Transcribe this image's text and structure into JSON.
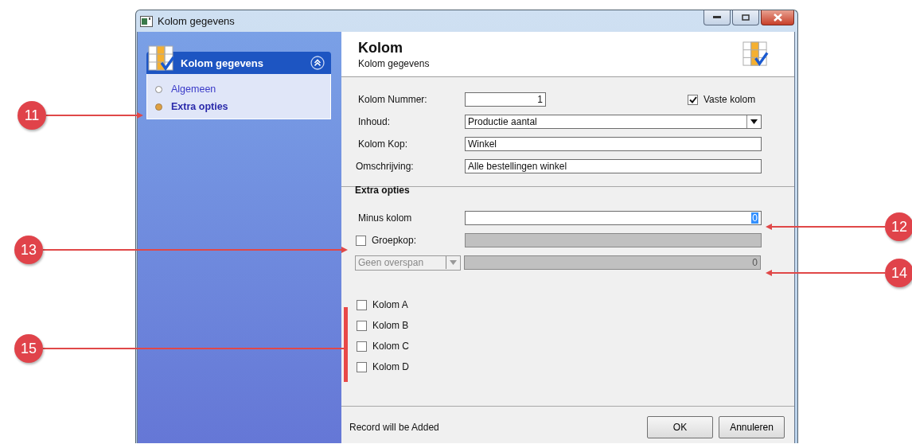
{
  "window": {
    "title": "Kolom gegevens"
  },
  "sidebar": {
    "panel": {
      "title": "Kolom gegevens",
      "expanded": true,
      "items": [
        {
          "label": "Algemeen",
          "selected": false
        },
        {
          "label": "Extra opties",
          "selected": true
        }
      ]
    }
  },
  "header": {
    "title": "Kolom",
    "subtitle": "Kolom gegevens"
  },
  "fixed_column": {
    "label": "Vaste kolom",
    "checked": true
  },
  "fields": [
    {
      "kind": "number",
      "label": "Kolom Nummer:",
      "value": "1"
    },
    {
      "kind": "select",
      "label": "Inhoud:",
      "value": "Productie aantal"
    },
    {
      "kind": "text",
      "label": "Kolom Kop:",
      "value": "Winkel"
    },
    {
      "kind": "text",
      "label": "Omschrijving:",
      "value": "Alle bestellingen winkel"
    }
  ],
  "extra_options": {
    "title": "Extra opties",
    "minus_column": {
      "label": "Minus kolom",
      "value": "0",
      "value_selected": true
    },
    "group_header": {
      "label": "Groepkop:",
      "checked": false,
      "field_disabled": true
    },
    "span": {
      "value": "Geen overspan",
      "disabled": true
    },
    "span_count": {
      "value": "0",
      "disabled": true
    },
    "columns": [
      {
        "label": "Kolom A",
        "checked": false
      },
      {
        "label": "Kolom B",
        "checked": false
      },
      {
        "label": "Kolom C",
        "checked": false
      },
      {
        "label": "Kolom D",
        "checked": false
      }
    ]
  },
  "status": "Record will be Added",
  "buttons": [
    {
      "label": "OK"
    },
    {
      "label": "Annuleren"
    }
  ],
  "callouts": [
    {
      "number": "11",
      "kind": "arrow"
    },
    {
      "number": "12",
      "kind": "arrow"
    },
    {
      "number": "13",
      "kind": "arrow"
    },
    {
      "number": "14",
      "kind": "arrow"
    },
    {
      "number": "15",
      "kind": "bracket"
    }
  ]
}
